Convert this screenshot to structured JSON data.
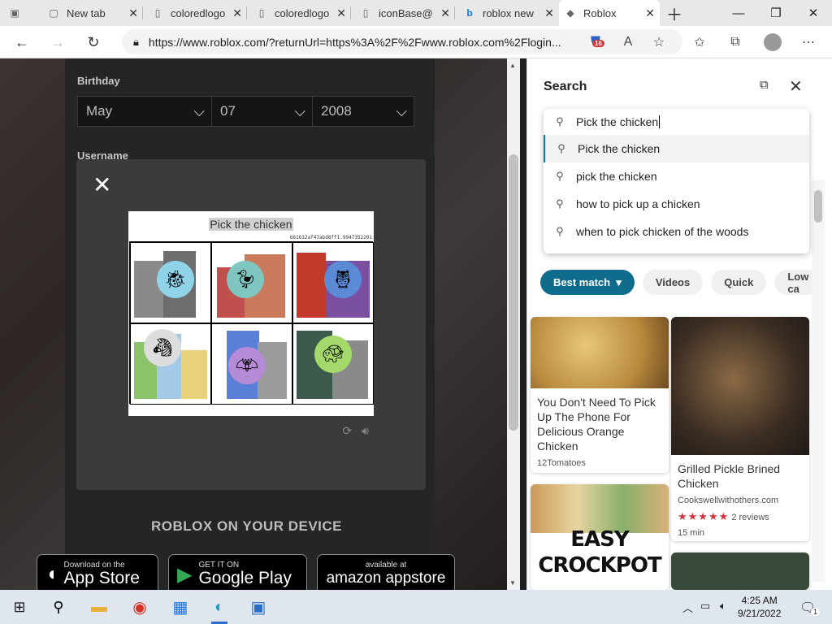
{
  "browser": {
    "tabs": [
      {
        "label": "",
        "icon": "tab-actions-icon"
      },
      {
        "label": "New tab",
        "icon": "new-tab-icon"
      },
      {
        "label": "coloredlogo",
        "icon": "page-icon"
      },
      {
        "label": "coloredlogo",
        "icon": "page-icon"
      },
      {
        "label": "iconBase@",
        "icon": "page-icon"
      },
      {
        "label": "roblox new",
        "icon": "bing-icon"
      },
      {
        "label": "Roblox",
        "icon": "roblox-icon"
      }
    ],
    "address": "https://www.roblox.com/?returnUrl=https%3A%2F%2Fwww.roblox.com%2Flogin...",
    "tracker_badge": "16"
  },
  "signup": {
    "birthday_label": "Birthday",
    "month": "May",
    "day": "07",
    "year": "2008",
    "username_label": "Username"
  },
  "captcha": {
    "prompt": "Pick the chicken",
    "id": "661632af47abd8ff1.9947352201"
  },
  "device": {
    "title": "ROBLOX ON YOUR DEVICE",
    "stores": [
      {
        "small": "Download on the",
        "large": "App Store"
      },
      {
        "small": "GET IT ON",
        "large": "Google Play"
      },
      {
        "small": "available at",
        "large": "amazon appstore"
      }
    ]
  },
  "search_panel": {
    "title": "Search",
    "query": "Pick the chicken",
    "suggestions": [
      "Pick the chicken",
      "pick the chicken",
      "how to pick up a chicken",
      "when to pick chicken of the woods"
    ],
    "filters": [
      "Best match",
      "Videos",
      "Quick",
      "Low ca"
    ],
    "cards": [
      {
        "title": "You Don't Need To Pick Up The Phone For Delicious Orange Chicken",
        "source": "12Tomatoes"
      },
      {
        "title": "Grilled Pickle Brined Chicken",
        "source": "Cookswellwithothers.com",
        "rating": "2 reviews",
        "time": "15 min"
      },
      {
        "title": "EASY CROCKPOT"
      }
    ]
  },
  "taskbar": {
    "time": "4:25 AM",
    "date": "9/21/2022",
    "notifications": "1"
  },
  "colors": {
    "accent": "#0f6c8c",
    "badge": "#d13438"
  }
}
